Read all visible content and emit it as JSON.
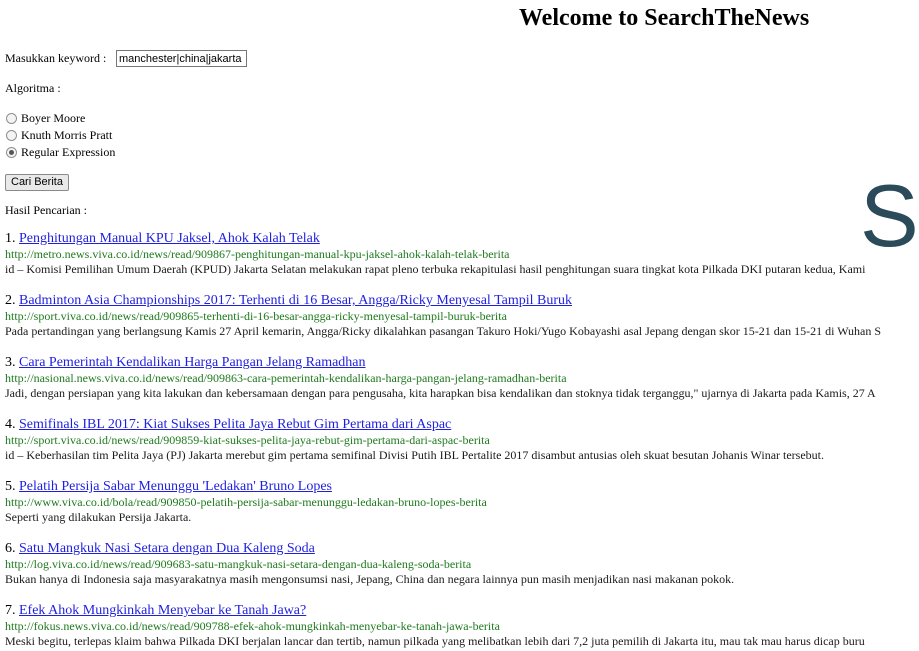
{
  "header": {
    "title": "Welcome to SearchTheNews"
  },
  "form": {
    "keyword_label": "Masukkan keyword :",
    "keyword_value": "manchester|china|jakarta",
    "algorithm_label": "Algoritma :",
    "algorithms": [
      {
        "label": "Boyer Moore",
        "checked": false
      },
      {
        "label": "Knuth Morris Pratt",
        "checked": false
      },
      {
        "label": "Regular Expression",
        "checked": true
      }
    ],
    "search_button": "Cari Berita"
  },
  "results_label": "Hasil Pencarian :",
  "logo_letter": "S",
  "results": [
    {
      "number": "1.",
      "title": "Penghitungan Manual KPU Jaksel, Ahok Kalah Telak",
      "url": "http://metro.news.viva.co.id/news/read/909867-penghitungan-manual-kpu-jaksel-ahok-kalah-telak-berita",
      "snippet": "id – Komisi Pemilihan Umum Daerah (KPUD) Jakarta Selatan melakukan rapat pleno terbuka rekapitulasi hasil penghitungan suara tingkat kota Pilkada DKI putaran kedua, Kami"
    },
    {
      "number": "2.",
      "title": "Badminton Asia Championships 2017: Terhenti di 16 Besar, Angga/Ricky Menyesal Tampil Buruk",
      "url": "http://sport.viva.co.id/news/read/909865-terhenti-di-16-besar-angga-ricky-menyesal-tampil-buruk-berita",
      "snippet": "Pada pertandingan yang berlangsung Kamis 27 April kemarin, Angga/Ricky dikalahkan pasangan Takuro Hoki/Yugo Kobayashi asal Jepang dengan skor 15-21 dan 15-21 di Wuhan S"
    },
    {
      "number": "3.",
      "title": "Cara Pemerintah Kendalikan Harga Pangan Jelang Ramadhan",
      "url": "http://nasional.news.viva.co.id/news/read/909863-cara-pemerintah-kendalikan-harga-pangan-jelang-ramadhan-berita",
      "snippet": "Jadi, dengan persiapan yang kita lakukan dan kebersamaan dengan para pengusaha, kita harapkan bisa kendalikan dan stoknya tidak terganggu,\" ujarnya di Jakarta pada Kamis, 27 A"
    },
    {
      "number": "4.",
      "title": "Semifinals IBL 2017: Kiat Sukses Pelita Jaya Rebut Gim Pertama dari Aspac",
      "url": "http://sport.viva.co.id/news/read/909859-kiat-sukses-pelita-jaya-rebut-gim-pertama-dari-aspac-berita",
      "snippet": "id – Keberhasilan tim Pelita Jaya (PJ) Jakarta merebut gim pertama semifinal Divisi Putih IBL Pertalite 2017 disambut antusias oleh skuat besutan Johanis Winar tersebut."
    },
    {
      "number": "5.",
      "title": "Pelatih Persija Sabar Menunggu 'Ledakan' Bruno Lopes",
      "url": "http://www.viva.co.id/bola/read/909850-pelatih-persija-sabar-menunggu-ledakan-bruno-lopes-berita",
      "snippet": "Seperti yang dilakukan Persija Jakarta."
    },
    {
      "number": "6.",
      "title": "Satu Mangkuk Nasi Setara dengan Dua Kaleng Soda",
      "url": "http://log.viva.co.id/news/read/909683-satu-mangkuk-nasi-setara-dengan-dua-kaleng-soda-berita",
      "snippet": "Bukan hanya di Indonesia saja masyarakatnya masih mengonsumsi nasi, Jepang, China dan negara lainnya pun masih menjadikan nasi makanan pokok."
    },
    {
      "number": "7.",
      "title": "Efek Ahok Mungkinkah Menyebar ke Tanah Jawa?",
      "url": "http://fokus.news.viva.co.id/news/read/909788-efek-ahok-mungkinkah-menyebar-ke-tanah-jawa-berita",
      "snippet": "Meski begitu, terlepas klaim bahwa Pilkada DKI berjalan lancar dan tertib, namun pilkada yang melibatkan lebih dari 7,2 juta pemilih di Jakarta itu, mau tak mau harus dicap buru"
    }
  ]
}
